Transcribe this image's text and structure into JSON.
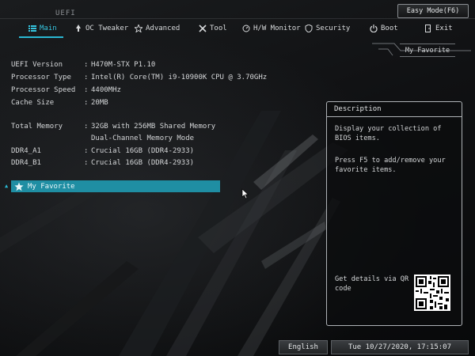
{
  "header": {
    "brand_label": "UEFI",
    "easy_mode_label": "Easy Mode(F6)"
  },
  "tabs": [
    {
      "label": "Main",
      "icon": "list-icon",
      "active": true
    },
    {
      "label": "OC Tweaker",
      "icon": "rocket-icon",
      "active": false
    },
    {
      "label": "Advanced",
      "icon": "star-icon",
      "active": false
    },
    {
      "label": "Tool",
      "icon": "tools-icon",
      "active": false
    },
    {
      "label": "H/W Monitor",
      "icon": "monitor-icon",
      "active": false
    },
    {
      "label": "Security",
      "icon": "shield-icon",
      "active": false
    },
    {
      "label": "Boot",
      "icon": "power-icon",
      "active": false
    },
    {
      "label": "Exit",
      "icon": "exit-door-icon",
      "active": false
    }
  ],
  "favorite_badge": "My Favorite",
  "info": {
    "uefi_version": {
      "key": "UEFI Version",
      "value": "H470M-STX P1.10"
    },
    "processor_type": {
      "key": "Processor Type",
      "value": "Intel(R) Core(TM) i9-10900K CPU @ 3.70GHz"
    },
    "processor_speed": {
      "key": "Processor Speed",
      "value": "4400MHz"
    },
    "cache_size": {
      "key": "Cache Size",
      "value": "20MB"
    },
    "total_memory": {
      "key": "Total Memory",
      "value": "32GB with 256MB Shared Memory",
      "value2": "Dual-Channel Memory Mode"
    },
    "ddr4_a1": {
      "key": "DDR4_A1",
      "value": "Crucial 16GB (DDR4-2933)"
    },
    "ddr4_b1": {
      "key": "DDR4_B1",
      "value": "Crucial 16GB (DDR4-2933)"
    },
    "separator": ":"
  },
  "favorite_item": {
    "label": "My Favorite"
  },
  "description": {
    "title": "Description",
    "line1": "Display your collection of BIOS items.",
    "line2": "Press F5 to add/remove your favorite items.",
    "qr_text": "Get details via QR code"
  },
  "footer": {
    "language": "English",
    "datetime": "Tue 10/27/2020, 17:15:07"
  },
  "colors": {
    "accent": "#2ab8d3",
    "highlight_row": "#1f8ea3"
  }
}
